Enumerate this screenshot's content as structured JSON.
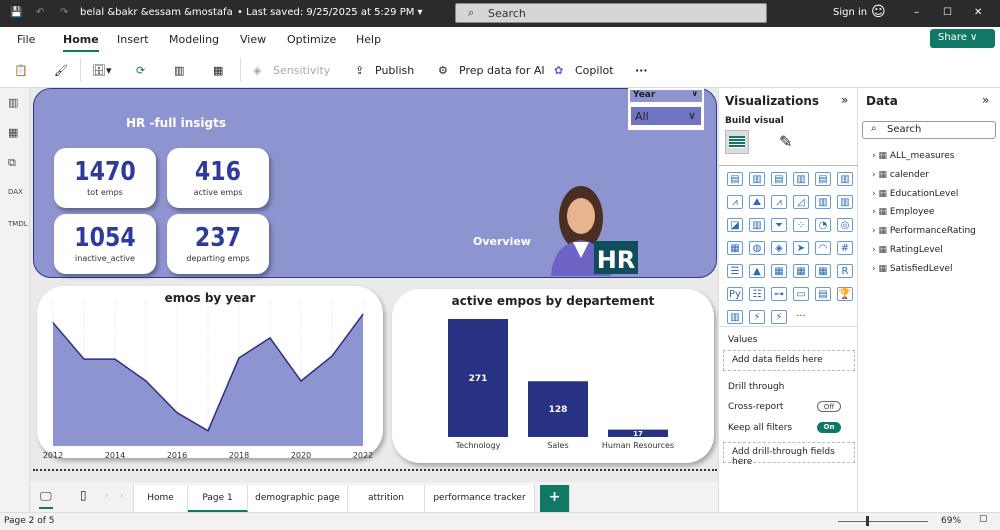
{
  "titlebar": {
    "title": "belal &bakr &essam &mostafa",
    "saved": "• Last saved: 9/25/2025 at 5:29 PM ▾",
    "search": "Search",
    "sign_in": "Sign in"
  },
  "ribbon": {
    "tabs": [
      "File",
      "Home",
      "Insert",
      "Modeling",
      "View",
      "Optimize",
      "Help"
    ],
    "active": "Home",
    "share": "Share ∨"
  },
  "toolbar": {
    "sensitivity": "Sensitivity",
    "publish": "Publish",
    "prep": "Prep data for AI",
    "copilot": "Copilot",
    "more": "···"
  },
  "report": {
    "title": "HR -full insigts",
    "overview": "Overview",
    "badge": "HR",
    "kpis": [
      {
        "value": "1470",
        "label": "tot emps"
      },
      {
        "value": "416",
        "label": "active emps"
      },
      {
        "value": "1054",
        "label": "inactive_active"
      },
      {
        "value": "237",
        "label": "departing emps"
      }
    ],
    "slicer": {
      "label": "Year",
      "value": "All"
    }
  },
  "chart_data": [
    {
      "type": "area",
      "title": "emos by year",
      "x": [
        2012,
        2013,
        2014,
        2015,
        2016,
        2017,
        2018,
        2019,
        2020,
        2021,
        2022
      ],
      "values": [
        203,
        143,
        143,
        107,
        55,
        25,
        145,
        178,
        107,
        148,
        217
      ],
      "x_ticks": [
        "2012",
        "2014",
        "2016",
        "2018",
        "2020",
        "2022"
      ],
      "grid": "vertical",
      "color": "#8e94d0",
      "line_color": "#2b3080"
    },
    {
      "type": "bar",
      "title": "active empos by departement",
      "categories": [
        "Technology",
        "Sales",
        "Human Resources"
      ],
      "values": [
        271,
        128,
        17
      ],
      "data_labels": [
        "271",
        "128",
        "17"
      ],
      "color": "#283282"
    }
  ],
  "viz_pane": {
    "title": "Visualizations",
    "build": "Build visual",
    "values": "Values",
    "add_fields": "Add data fields here",
    "drill": "Drill through",
    "cross": "Cross-report",
    "cross_state": "Off",
    "keep": "Keep all filters",
    "keep_state": "On",
    "add_drill": "Add drill-through fields here"
  },
  "data_pane": {
    "title": "Data",
    "search": "Search",
    "tables": [
      "ALL_measures",
      "calender",
      "EducationLevel",
      "Employee",
      "PerformanceRating",
      "RatingLevel",
      "SatisfiedLevel"
    ]
  },
  "pages": {
    "tabs": [
      "Home",
      "Page 1",
      "demographic page",
      "attrition",
      "performance tracker"
    ],
    "active": "Page 1",
    "add": "+"
  },
  "status": {
    "page": "Page 2 of 5",
    "zoom": "69%"
  },
  "colors": {
    "accent": "#117865",
    "hero": "#8e94d0",
    "kpi_text": "#2f3a9a",
    "bar": "#283282"
  }
}
